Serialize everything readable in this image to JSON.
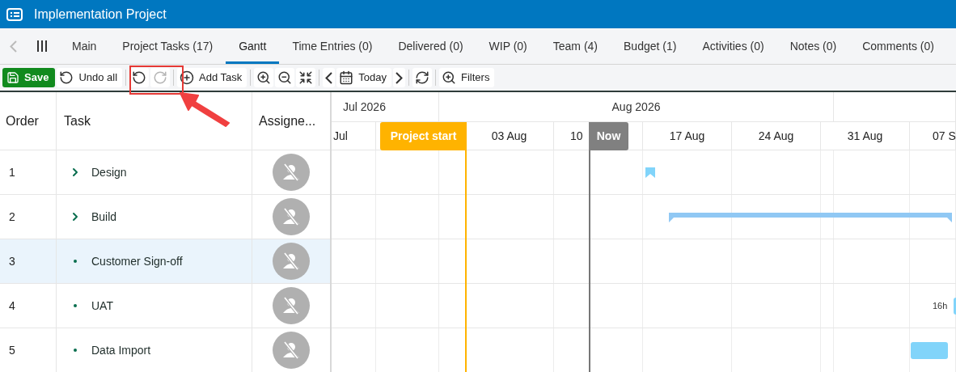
{
  "window": {
    "title": "Implementation Project"
  },
  "tabs": [
    {
      "label": "Main",
      "selected": false
    },
    {
      "label": "Project Tasks (17)",
      "selected": false
    },
    {
      "label": "Gantt",
      "selected": true
    },
    {
      "label": "Time Entries (0)",
      "selected": false
    },
    {
      "label": "Delivered (0)",
      "selected": false
    },
    {
      "label": "WIP (0)",
      "selected": false
    },
    {
      "label": "Team (4)",
      "selected": false
    },
    {
      "label": "Budget (1)",
      "selected": false
    },
    {
      "label": "Activities (0)",
      "selected": false
    },
    {
      "label": "Notes (0)",
      "selected": false
    },
    {
      "label": "Comments (0)",
      "selected": false
    }
  ],
  "toolbar": [
    {
      "kind": "save",
      "label": "Save",
      "disabled": false
    },
    {
      "kind": "undo-all",
      "label": "Undo all",
      "disabled": false
    },
    {
      "kind": "undo",
      "disabled": false
    },
    {
      "kind": "redo",
      "disabled": true
    },
    {
      "kind": "add",
      "label": "Add Task",
      "disabled": false
    },
    {
      "kind": "zoom-in",
      "disabled": false
    },
    {
      "kind": "zoom-out",
      "disabled": false
    },
    {
      "kind": "fit",
      "disabled": false
    },
    {
      "kind": "prev",
      "disabled": false
    },
    {
      "kind": "today",
      "label": "Today",
      "disabled": false
    },
    {
      "kind": "next",
      "disabled": false
    },
    {
      "kind": "refresh",
      "disabled": false
    },
    {
      "kind": "filters",
      "label": "Filters",
      "disabled": false
    }
  ],
  "table": {
    "columns": [
      "Order",
      "Task",
      "Assigne..."
    ],
    "rows": [
      {
        "order": "1",
        "task": "Design",
        "kind": "group",
        "selected": false
      },
      {
        "order": "2",
        "task": "Build",
        "kind": "group",
        "selected": false
      },
      {
        "order": "3",
        "task": "Customer Sign-off",
        "kind": "task",
        "selected": true
      },
      {
        "order": "4",
        "task": "UAT",
        "kind": "task",
        "selected": false
      },
      {
        "order": "5",
        "task": "Data Import",
        "kind": "task",
        "selected": false
      }
    ]
  },
  "timeline": {
    "months": [
      "Jul 2026",
      "Aug 2026"
    ],
    "weeks": [
      "Jul",
      "03 Aug",
      "10",
      "17 Aug",
      "24 Aug",
      "31 Aug",
      "07 S"
    ],
    "markers": [
      {
        "kind": "start",
        "label": "Project start"
      },
      {
        "kind": "now",
        "label": "Now"
      }
    ],
    "bars": [
      {
        "kind": "milestone"
      },
      {
        "kind": "summary"
      },
      {
        "kind": "none"
      },
      {
        "kind": "task",
        "label": "16h"
      },
      {
        "kind": "task"
      }
    ]
  }
}
